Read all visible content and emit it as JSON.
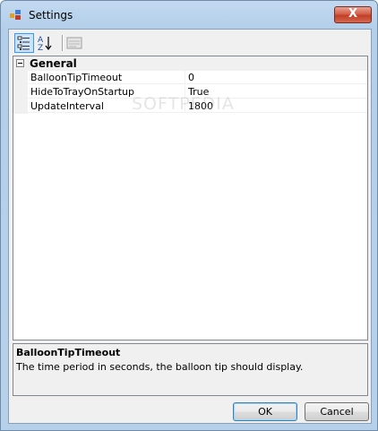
{
  "window": {
    "title": "Settings",
    "close_label": "X"
  },
  "toolbar": {
    "buttons": [
      {
        "name": "categorized-view",
        "icon": "categorized-icon",
        "active": true
      },
      {
        "name": "alphabetical-view",
        "icon": "sort-az-icon",
        "active": false
      },
      {
        "name": "property-pages",
        "icon": "property-pages-icon",
        "active": false
      }
    ]
  },
  "grid": {
    "category": "General",
    "properties": [
      {
        "name": "BalloonTipTimeout",
        "value": "0"
      },
      {
        "name": "HideToTrayOnStartup",
        "value": "True"
      },
      {
        "name": "UpdateInterval",
        "value": "1800"
      }
    ]
  },
  "description": {
    "title": "BalloonTipTimeout",
    "text": "The time period in seconds, the balloon tip should display."
  },
  "buttons": {
    "ok": "OK",
    "cancel": "Cancel"
  },
  "watermark": "SOFTPEDIA",
  "colors": {
    "accent": "#3399ff",
    "titlebar": "#b6d0ea",
    "close": "#c23e26"
  }
}
